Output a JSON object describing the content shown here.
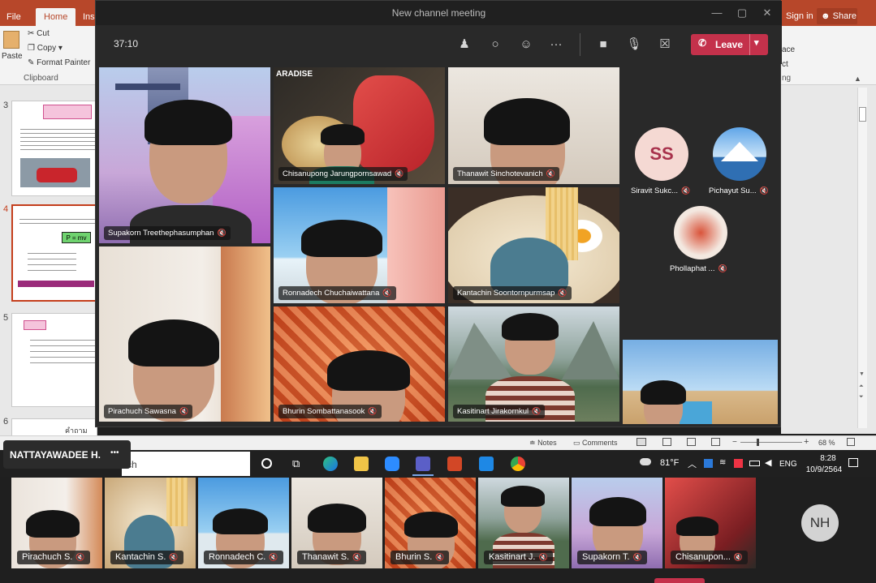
{
  "powerpoint": {
    "tabs": {
      "file": "File",
      "home": "Home",
      "insert": "Inse"
    },
    "sign_in": "Sign in",
    "share": "Share",
    "clipboard": {
      "paste": "Paste",
      "cut": "Cut",
      "copy": "Copy",
      "format_painter": "Format Painter",
      "group": "Clipboard"
    },
    "ribbon_right": {
      "ace": "ace",
      "ct": "ct",
      "ng": "ng"
    },
    "slide_numbers": [
      "3",
      "4",
      "5",
      "6"
    ],
    "thumb_equation": "P = mv",
    "notes_text": "คำถาม",
    "status": {
      "notes": "Notes",
      "comments": "Comments",
      "zoom": "68 %"
    }
  },
  "taskbar": {
    "search_fragment": "ch",
    "weather": "81°F",
    "lang": "ENG",
    "time": "8:28",
    "date": "10/9/2564"
  },
  "teams": {
    "window_title": "New channel meeting",
    "timer": "37:10",
    "leave": "Leave",
    "paradise_text": "ARADISE",
    "tiles": [
      {
        "name": "Supakorn Treethephasumphan"
      },
      {
        "name": "Chisanupong Jarungpornsawad"
      },
      {
        "name": "Thanawit Sinchotevanich"
      },
      {
        "name": "Ronnadech Chuchaiwattana"
      },
      {
        "name": "Kantachin Soontornpurmsap"
      },
      {
        "name": "Pirachuch Sawasna"
      },
      {
        "name": "Bhurin Sombattanasook"
      },
      {
        "name": "Kasitinart Jirakornkul"
      }
    ],
    "side_avatars": [
      {
        "initials": "SS",
        "name": "Siravit Sukc..."
      },
      {
        "name": "Pichayut Su..."
      },
      {
        "name": "Phollaphat ..."
      }
    ]
  },
  "overlay": {
    "self_name": "NATTAYAWADEE H.",
    "more": "•••",
    "self_initials": "NH",
    "strip": [
      {
        "name": "Pirachuch S."
      },
      {
        "name": "Kantachin S."
      },
      {
        "name": "Ronnadech C."
      },
      {
        "name": "Thanawit S."
      },
      {
        "name": "Bhurin S."
      },
      {
        "name": "Kasitinart J."
      },
      {
        "name": "Supakorn T."
      },
      {
        "name": "Chisanupon..."
      }
    ]
  },
  "colors": {
    "ppt_red": "#b7472a",
    "leave_red": "#c4314b",
    "teams_bg": "#292929",
    "ss_avatar": "#f5d9d3"
  }
}
